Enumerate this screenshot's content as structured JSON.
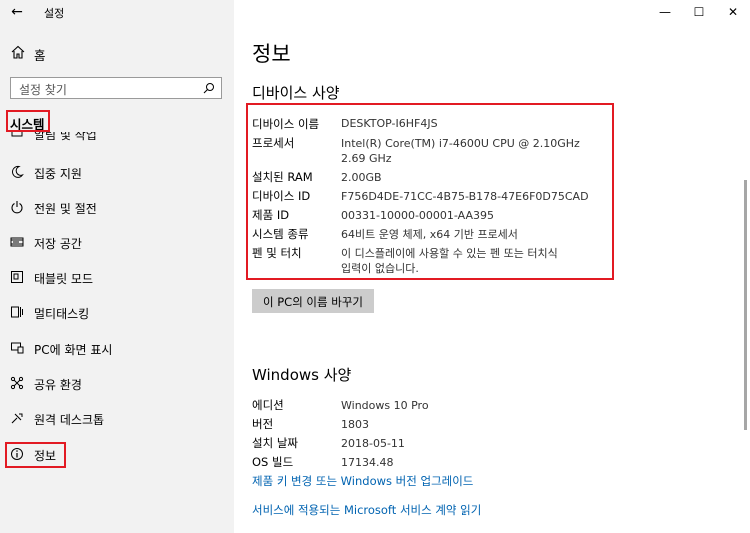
{
  "app": {
    "title": "설정",
    "back_icon": "←"
  },
  "window_controls": {
    "minimize": "—",
    "maximize": "☐",
    "close": "✕"
  },
  "sidebar": {
    "home_label": "홈",
    "search_placeholder": "설정 찾기",
    "section_label": "시스템",
    "partial_item_label": "알림 및 작업",
    "items": [
      {
        "label": "집중 지원",
        "icon": "moon-icon"
      },
      {
        "label": "전원 및 절전",
        "icon": "power-icon"
      },
      {
        "label": "저장 공간",
        "icon": "storage-icon"
      },
      {
        "label": "태블릿 모드",
        "icon": "tablet-icon"
      },
      {
        "label": "멀티태스킹",
        "icon": "multitasking-icon"
      },
      {
        "label": "PC에 화면 표시",
        "icon": "project-icon"
      },
      {
        "label": "공유 환경",
        "icon": "shared-experience-icon"
      },
      {
        "label": "원격 데스크톱",
        "icon": "remote-desktop-icon"
      },
      {
        "label": "정보",
        "icon": "info-icon"
      }
    ]
  },
  "main": {
    "title": "정보",
    "device_specs": {
      "heading": "디바이스 사양",
      "rows": [
        {
          "label": "디바이스 이름",
          "value": "DESKTOP-I6HF4JS"
        },
        {
          "label": "프로세서",
          "value": "Intel(R) Core(TM) i7-4600U CPU @ 2.10GHz",
          "value2": "2.69 GHz"
        },
        {
          "label": "설치된 RAM",
          "value": "2.00GB"
        },
        {
          "label": "디바이스 ID",
          "value": "F756D4DE-71CC-4B75-B178-47E6F0D75CAD"
        },
        {
          "label": "제품 ID",
          "value": "00331-10000-00001-AA395"
        },
        {
          "label": "시스템 종류",
          "value": "64비트 운영 체제, x64 기반 프로세서"
        },
        {
          "label": "펜 및 터치",
          "value": "이 디스플레이에 사용할 수 있는 펜 또는 터치식",
          "value2": "입력이 없습니다."
        }
      ],
      "rename_button": "이 PC의 이름 바꾸기"
    },
    "windows_specs": {
      "heading": "Windows 사양",
      "rows": [
        {
          "label": "에디션",
          "value": "Windows 10 Pro"
        },
        {
          "label": "버전",
          "value": "1803"
        },
        {
          "label": "설치 날짜",
          "value": "2018-05-11"
        },
        {
          "label": "OS 빌드",
          "value": "17134.48"
        }
      ],
      "links": [
        "제품 키 변경 또는 Windows 버전 업그레이드",
        "서비스에 적용되는 Microsoft 서비스 계약 읽기"
      ]
    }
  },
  "colors": {
    "highlight": "#e21a23",
    "link": "#0063b1",
    "sidebar_bg": "#f2f2f2",
    "button_bg": "#cccccc"
  }
}
